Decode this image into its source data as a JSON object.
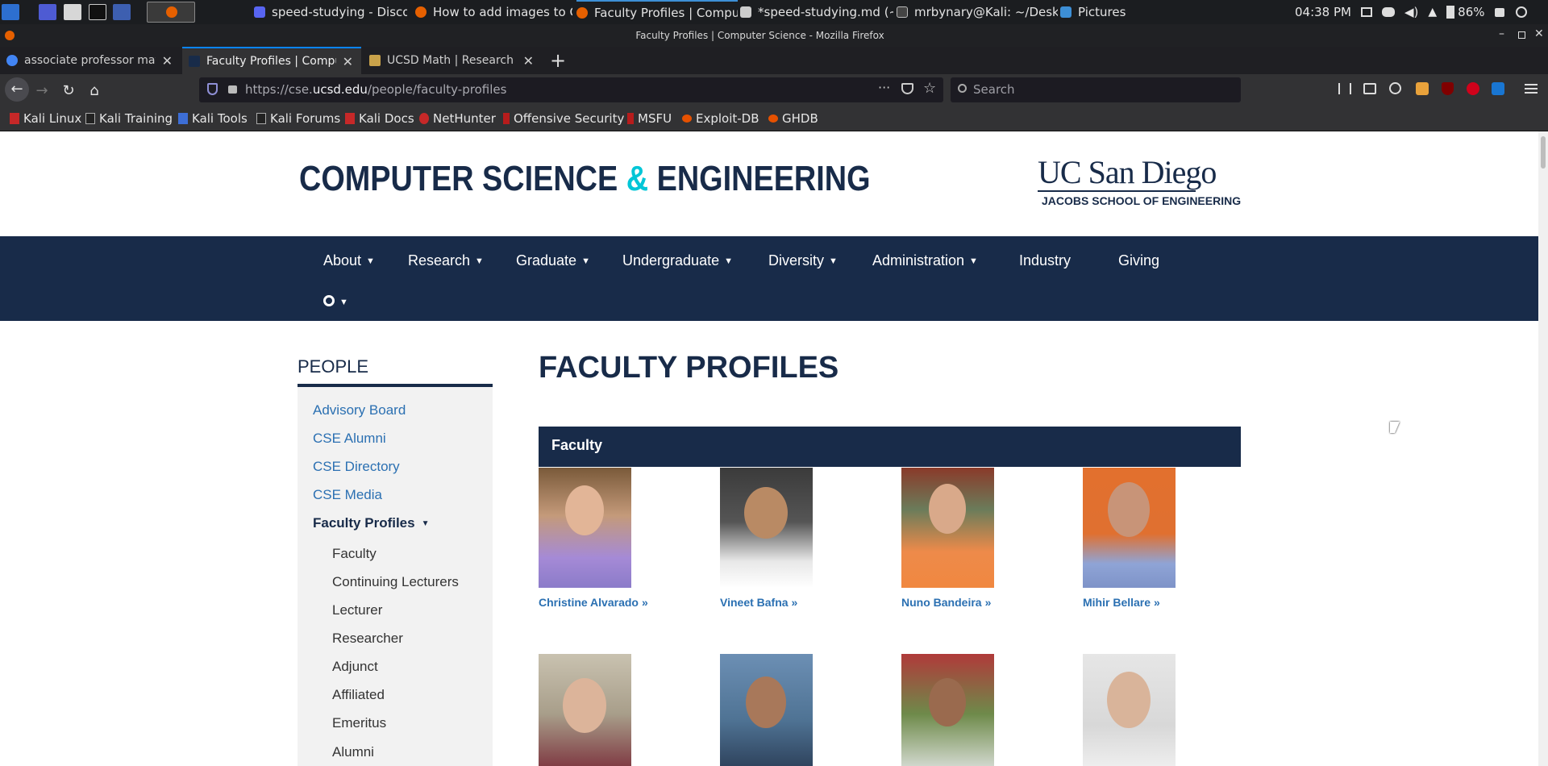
{
  "taskbar": {
    "windows": [
      {
        "label": "speed-studying - Discord",
        "color": "#5865f2"
      },
      {
        "label": "How to add images to Gi...",
        "color": "#e66000"
      },
      {
        "label": "Faculty Profiles | Compu...",
        "color": "#e66000"
      },
      {
        "label": "*speed-studying.md (~/...",
        "color": "#cccccc"
      },
      {
        "label": "mrbynary@Kali: ~/Desk...",
        "color": "#444444"
      },
      {
        "label": "Pictures",
        "color": "#3d8fd6"
      }
    ],
    "clock": "04:38 PM",
    "battery": "86%"
  },
  "window_title": "Faculty Profiles | Computer Science - Mozilla Firefox",
  "tabs": [
    {
      "label": "associate professor math",
      "color": "#4285f4"
    },
    {
      "label": "Faculty Profiles | Comput",
      "color": "#182b49"
    },
    {
      "label": "UCSD Math | Research A",
      "color": "#c9a24a"
    }
  ],
  "url": {
    "prefix": "https://cse.",
    "host": "ucsd.edu",
    "path": "/people/faculty-profiles"
  },
  "search_placeholder": "Search",
  "bookmarks": [
    "Kali Linux",
    "Kali Training",
    "Kali Tools",
    "Kali Forums",
    "Kali Docs",
    "NetHunter",
    "Offensive Security",
    "MSFU",
    "Exploit-DB",
    "GHDB"
  ],
  "site": {
    "title_part1": "COMPUTER SCIENCE ",
    "title_amp": "&",
    "title_part2": " ENGINEERING",
    "logo_main": "UC San Diego",
    "logo_sub": "JACOBS SCHOOL OF ENGINEERING"
  },
  "nav": [
    "About",
    "Research",
    "Graduate",
    "Undergraduate",
    "Diversity",
    "Administration",
    "Industry",
    "Giving"
  ],
  "sidebar": {
    "heading": "PEOPLE",
    "links": [
      "Advisory Board",
      "CSE Alumni",
      "CSE Directory",
      "CSE Media"
    ],
    "active": "Faculty Profiles",
    "subitems": [
      "Faculty",
      "Continuing Lecturers",
      "Lecturer",
      "Researcher",
      "Adjunct",
      "Affiliated",
      "Emeritus",
      "Alumni"
    ]
  },
  "main": {
    "title": "FACULTY PROFILES",
    "section": "Faculty",
    "people": [
      "Christine Alvarado",
      "Vineet Bafna",
      "Nuno Bandeira",
      "Mihir Bellare"
    ]
  }
}
